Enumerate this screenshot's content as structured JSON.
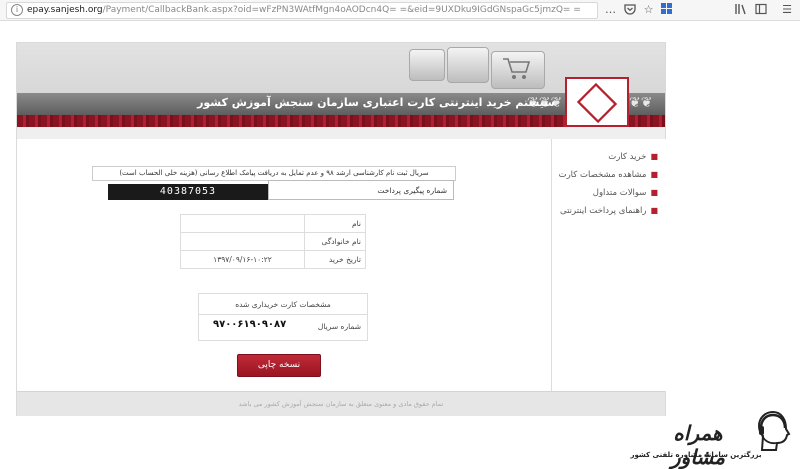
{
  "browser": {
    "url_domain": "epay.sanjesh.org",
    "url_rest": "/Payment/CallbackBank.aspx?oid=wFzPN3WAtfMgn4oAODcn4Q= =&eid=9UXDku9IGdGNspaGc5jmzQ= =",
    "icons": [
      "info-icon",
      "ellipsis-icon",
      "pocket-icon",
      "star-icon",
      "windows-icon",
      "library-icon",
      "sidebar-icon",
      "menu-icon"
    ]
  },
  "site": {
    "banner_title": "سیستم خرید اینترنتی کارت اعتباری سازمان سنجش آموزش کشور",
    "colors": {
      "accent": "#b5202e",
      "dark_band": "#6a6a6a"
    }
  },
  "sidebar": {
    "items": [
      {
        "label": "خرید کارت"
      },
      {
        "label": "مشاهده مشخصات کارت"
      },
      {
        "label": "سوالات متداول"
      },
      {
        "label": "راهنمای پرداخت اینترنتی"
      }
    ]
  },
  "main": {
    "notice": "سریال ثبت نام کارشناسی ارشد ۹۸ و عدم تمایل به دریافت پیامک اطلاع رسانی (هزینه خلی الحساب است)",
    "tracking_label": "شماره پیگیری پرداخت",
    "tracking_value": "40387053",
    "info_rows": [
      {
        "label": "نام",
        "value": ""
      },
      {
        "label": "نام خانوادگی",
        "value": ""
      },
      {
        "label": "تاریخ خرید",
        "value": "۱۳۹۷/۰۹/۱۶-۱۰:۲۲"
      }
    ],
    "card_title": "مشخصات کارت خریداری شده",
    "card_serial_label": "شماره سریال",
    "card_serial_value": "۹۷۰۰۶۱۹۰۹۰۸۷",
    "print_button": "نسخه چاپی"
  },
  "footer": {
    "text": "تمام حقوق مادی و معنوی متعلق به سازمان سنجش آموزش کشور می باشد"
  },
  "watermark": {
    "brand": "همراه مشاور",
    "tagline": "بزرگترین سامانه مشاوره تلفنی کشور"
  }
}
